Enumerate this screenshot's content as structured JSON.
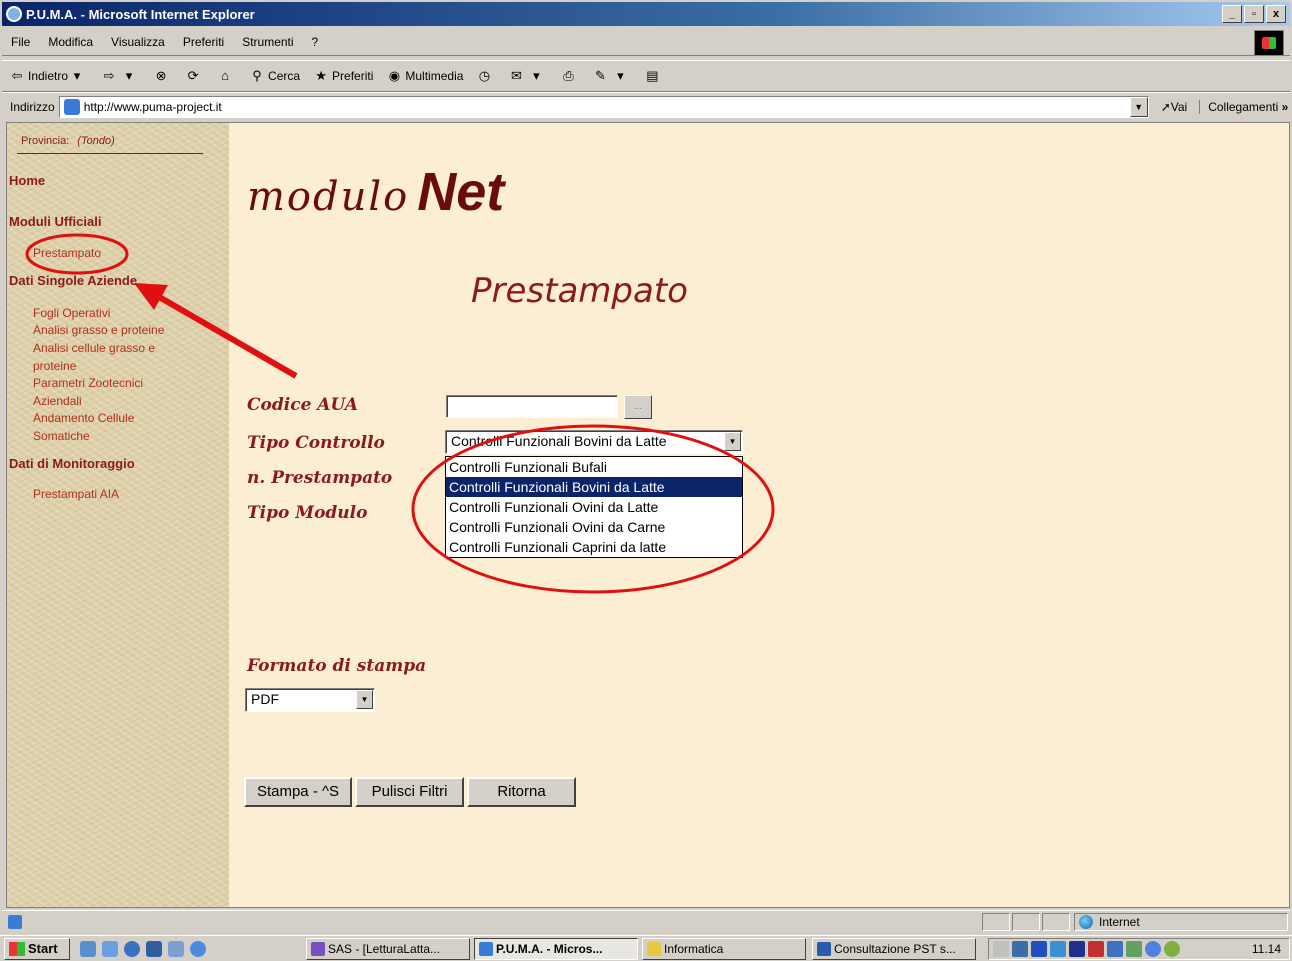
{
  "window": {
    "title": "P.U.M.A. - Microsoft Internet Explorer",
    "btn_min": "_",
    "btn_max": "▫",
    "btn_close": "x"
  },
  "menu": [
    "File",
    "Modifica",
    "Visualizza",
    "Preferiti",
    "Strumenti",
    "?"
  ],
  "toolbar": {
    "back": "Indietro",
    "back_arrow": "⇦",
    "search": "Cerca",
    "favorites": "Preferiti",
    "media": "Multimedia"
  },
  "address": {
    "label": "Indirizzo",
    "url": "http://www.puma-project.it",
    "go": "Vai",
    "links": "Collegamenti",
    "links_more": "»"
  },
  "sidebar": {
    "provincia_label": "Provincia:",
    "provincia_value": "(Tondo)",
    "home": "Home",
    "moduli_ufficiali": "Moduli Ufficiali",
    "prestampato": "Prestampato",
    "dati_singole": "Dati Singole Aziende",
    "dati_singole_items": [
      "Fogli Operativi",
      "Analisi grasso e proteine",
      "Analisi cellule grasso e proteine",
      "Parametri Zootecnici Aziendali",
      "Andamento Cellule Somatiche"
    ],
    "dati_monitoraggio": "Dati di Monitoraggio",
    "monitoraggio_items": [
      "Prestampati AIA"
    ]
  },
  "main": {
    "logo_modulo": "modulo",
    "logo_net": "Net",
    "title": "Prestampato",
    "codice_aua_label": "Codice AUA",
    "codice_aua_value": "",
    "browse_btn": "...",
    "tipo_controllo_label": "Tipo Controllo",
    "tipo_controllo_selected": "Controlli Funzionali Bovini da Latte",
    "tipo_controllo_options": [
      "Controlli Funzionali Bufali",
      "Controlli Funzionali Bovini da Latte",
      "Controlli Funzionali Ovini da Latte",
      "Controlli Funzionali Ovini da Carne",
      "Controlli Funzionali Caprini da latte"
    ],
    "n_prestampato_label": "n. Prestampato",
    "tipo_modulo_label": "Tipo Modulo",
    "formato_label": "Formato di stampa",
    "formato_selected": "PDF",
    "btn_stampa": "Stampa - ^S",
    "btn_pulisci": "Pulisci Filtri",
    "btn_ritorna": "Ritorna"
  },
  "status": {
    "zone": "Internet"
  },
  "taskbar": {
    "start": "Start",
    "tasks": [
      "SAS - [LetturaLatta...",
      "P.U.M.A. - Micros...",
      "Informatica",
      "Consultazione PST s..."
    ],
    "clock": "11.14"
  },
  "colors": {
    "accent": "#8b1a1a",
    "annotation": "#e01010",
    "selection": "#0a246a",
    "page_bg": "#fbeed2"
  }
}
